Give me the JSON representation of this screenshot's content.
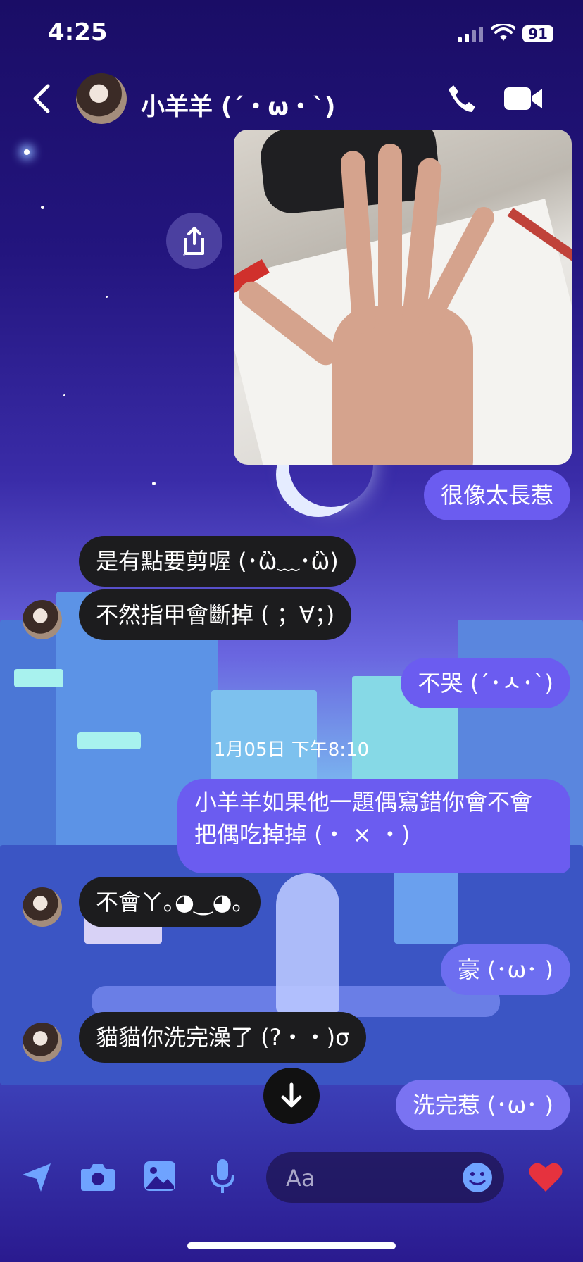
{
  "status_bar": {
    "time": "4:25",
    "battery": "91"
  },
  "header": {
    "contact_name": "小羊羊 (´・ω・`)"
  },
  "messages": {
    "m1": "很像太長惹",
    "m2": "是有點要剪喔 (･ὢ﹏･ὢ)",
    "m3": "不然指甲會斷掉 ( ；∀；)",
    "m4": "不哭 (´･ㅅ･`)",
    "m5": "小羊羊如果他一題偶寫錯你會不會把偶吃掉掉 (・ × ・)",
    "m6": "不會ㄚ｡◕‿◕｡",
    "m7": "豪 (･ω･ )",
    "m8": "貓貓你洗完澡了 (?・・)σ",
    "m9": "洗完惹 (･ω･ )"
  },
  "timestamp": "1月05日 下午8:10",
  "composer": {
    "placeholder": "Aa"
  },
  "colors": {
    "outgoing_bubble": "#6b5cf0",
    "incoming_bubble": "#1c1c1e"
  }
}
